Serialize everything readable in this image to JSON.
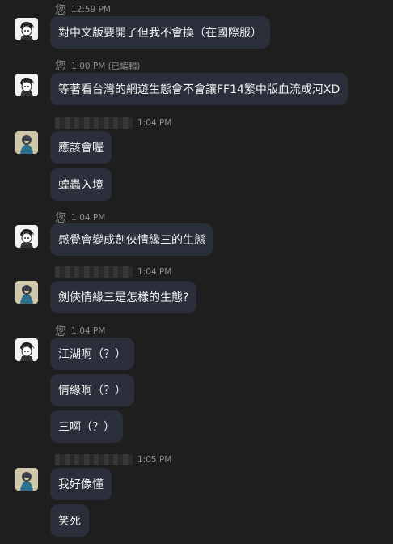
{
  "messages": [
    {
      "name": "您",
      "time": "12:59 PM",
      "text": "對中文版要開了但我不會換（在國際服）"
    },
    {
      "name": "您",
      "time": "1:00 PM (已編輯)",
      "text": "等著看台灣的網遊生態會不會讓FF14繁中版血流成河XD"
    },
    {
      "time": "1:04 PM",
      "texts": [
        "應該會喔",
        "蝗蟲入境"
      ]
    },
    {
      "name": "您",
      "time": "1:04 PM",
      "text": "感覺會變成劍俠情緣三的生態"
    },
    {
      "time": "1:04 PM",
      "text": "劍俠情緣三是怎樣的生態?"
    },
    {
      "name": "您",
      "time": "1:04 PM",
      "texts": [
        "江湖啊（？）",
        "情緣啊（？）",
        "三啊（？）"
      ]
    },
    {
      "time": "1:05 PM",
      "texts": [
        "我好像懂",
        "笑死"
      ]
    }
  ],
  "colors": {
    "background": "#1e1e1e",
    "bubble": "#2b2f3b"
  }
}
